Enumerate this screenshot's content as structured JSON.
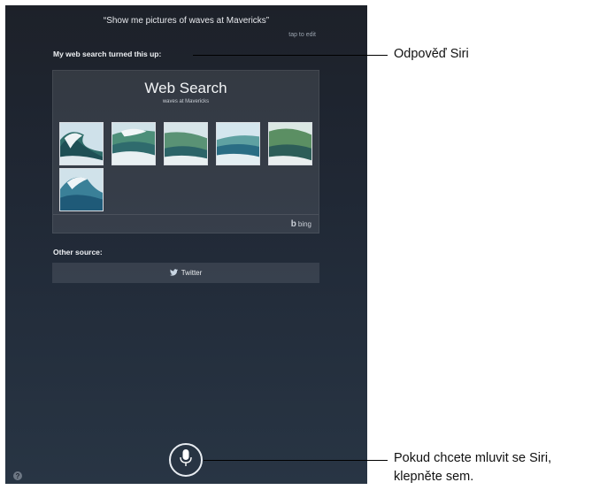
{
  "siri": {
    "query": "“Show me pictures of waves at Mavericks”",
    "tap_to_edit": "tap to edit",
    "web_label": "My web search turned this up:",
    "web_search_title": "Web Search",
    "web_search_subtitle": "waves at Mavericks",
    "bing_label": "bing",
    "other_source_label": "Other source:",
    "twitter_label": "Twitter",
    "help_label": "?",
    "thumbnail_count": 6
  },
  "callouts": {
    "answer": "Odpověď Siri",
    "mic_line1": "Pokud chcete mluvit se Siri,",
    "mic_line2": "klepněte sem."
  }
}
